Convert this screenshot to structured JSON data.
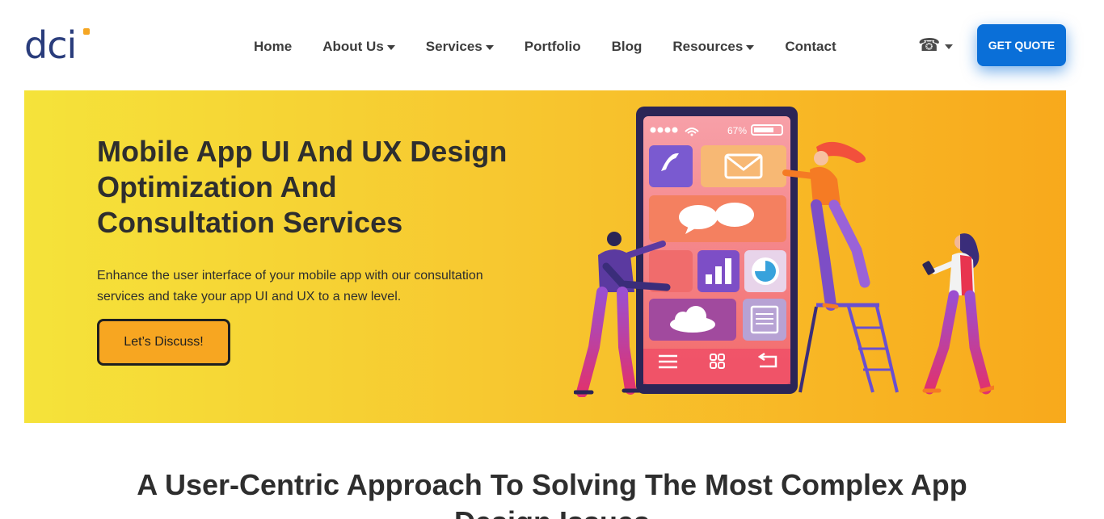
{
  "logo": {
    "text": "dci"
  },
  "nav": {
    "items": [
      {
        "label": "Home",
        "has_dropdown": false
      },
      {
        "label": "About Us",
        "has_dropdown": true
      },
      {
        "label": "Services",
        "has_dropdown": true
      },
      {
        "label": "Portfolio",
        "has_dropdown": false
      },
      {
        "label": "Blog",
        "has_dropdown": false
      },
      {
        "label": "Resources",
        "has_dropdown": true
      },
      {
        "label": "Contact",
        "has_dropdown": false
      }
    ]
  },
  "header": {
    "phone_icon": "telephone-icon",
    "quote_button": "GET QUOTE"
  },
  "hero": {
    "title_line1": "Mobile App UI And UX Design",
    "title_line2": "Optimization And",
    "title_line3": "Consultation Services",
    "description": "Enhance the user interface of your mobile app with our consultation services and take your app UI and UX to a new level.",
    "cta_label": "Let’s Discuss!",
    "phone_status": {
      "battery": "67%"
    }
  },
  "section": {
    "title": "A User-Centric Approach To Solving The Most Complex App Design Issues"
  },
  "colors": {
    "brand_blue": "#0a6fd8",
    "logo_navy": "#2a3d7c",
    "hero_gradient_start": "#f5e33a",
    "hero_gradient_end": "#f8a91c",
    "cta_orange": "#f7a621"
  }
}
